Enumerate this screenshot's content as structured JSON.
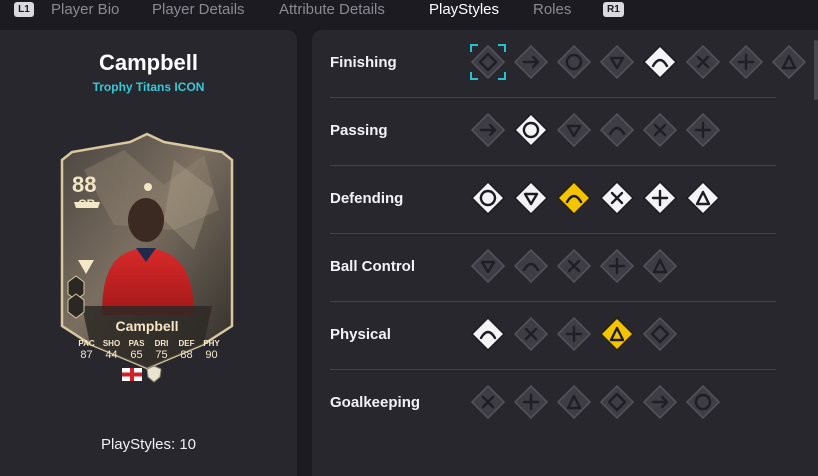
{
  "tabs": {
    "left_shoulder": "L1",
    "right_shoulder": "R1",
    "items": [
      {
        "label": "Player Bio",
        "active": false
      },
      {
        "label": "Player Details",
        "active": false
      },
      {
        "label": "Attribute Details",
        "active": false
      },
      {
        "label": "PlayStyles",
        "active": true
      },
      {
        "label": "Roles",
        "active": false
      }
    ]
  },
  "player": {
    "name": "Campbell",
    "version": "Trophy Titans ICON",
    "playstyles_count": "PlayStyles: 10"
  },
  "card": {
    "rating": "88",
    "position": "CB",
    "name": "Campbell",
    "stats": [
      {
        "label": "PAC",
        "value": "87"
      },
      {
        "label": "SHO",
        "value": "44"
      },
      {
        "label": "PAS",
        "value": "65"
      },
      {
        "label": "DRI",
        "value": "75"
      },
      {
        "label": "DEF",
        "value": "88"
      },
      {
        "label": "PHY",
        "value": "90"
      }
    ],
    "nation_icon": "england-flag-icon",
    "club_icon": "icons-club-badge-icon"
  },
  "colors": {
    "background": "#1c1b22",
    "panel": "#28272e",
    "icon_inactive": "#3e3d45",
    "icon_active": "#f4f4f6",
    "icon_plus": "#f5c400",
    "version_text": "#36c9d6",
    "focus": "#27c0d0"
  },
  "categories": [
    {
      "label": "Finishing",
      "icons": [
        {
          "name": "finesse-shot-icon",
          "state": "inactive",
          "focused": true
        },
        {
          "name": "chip-shot-icon",
          "state": "inactive"
        },
        {
          "name": "power-shot-icon",
          "state": "inactive"
        },
        {
          "name": "dead-ball-icon",
          "state": "inactive"
        },
        {
          "name": "power-header-icon",
          "state": "active"
        },
        {
          "name": "acrobatic-icon",
          "state": "inactive"
        },
        {
          "name": "low-driven-shot-icon",
          "state": "inactive"
        },
        {
          "name": "gamechanger-icon",
          "state": "inactive"
        }
      ]
    },
    {
      "label": "Passing",
      "icons": [
        {
          "name": "incisive-pass-icon",
          "state": "inactive"
        },
        {
          "name": "pinged-pass-icon",
          "state": "active"
        },
        {
          "name": "long-ball-pass-icon",
          "state": "inactive"
        },
        {
          "name": "tiki-taka-icon",
          "state": "inactive"
        },
        {
          "name": "whipped-pass-icon",
          "state": "inactive"
        },
        {
          "name": "inventive-icon",
          "state": "inactive"
        }
      ]
    },
    {
      "label": "Defending",
      "icons": [
        {
          "name": "jockey-icon",
          "state": "active"
        },
        {
          "name": "block-icon",
          "state": "active"
        },
        {
          "name": "intercept-icon",
          "state": "plus"
        },
        {
          "name": "anticipate-icon",
          "state": "active"
        },
        {
          "name": "slide-tackle-icon",
          "state": "active"
        },
        {
          "name": "bruiser-icon",
          "state": "active"
        }
      ]
    },
    {
      "label": "Ball Control",
      "icons": [
        {
          "name": "technical-icon",
          "state": "inactive"
        },
        {
          "name": "rapid-icon",
          "state": "inactive"
        },
        {
          "name": "first-touch-icon",
          "state": "inactive"
        },
        {
          "name": "trickster-icon",
          "state": "inactive"
        },
        {
          "name": "press-proven-icon",
          "state": "inactive"
        }
      ]
    },
    {
      "label": "Physical",
      "icons": [
        {
          "name": "quick-step-icon",
          "state": "active"
        },
        {
          "name": "relentless-icon",
          "state": "inactive"
        },
        {
          "name": "trivela-icon",
          "state": "inactive"
        },
        {
          "name": "aerial-icon",
          "state": "plus"
        },
        {
          "name": "long-throw-icon",
          "state": "inactive"
        }
      ]
    },
    {
      "label": "Goalkeeping",
      "icons": [
        {
          "name": "far-throw-icon",
          "state": "inactive"
        },
        {
          "name": "footwork-icon",
          "state": "inactive"
        },
        {
          "name": "cross-claimer-icon",
          "state": "inactive"
        },
        {
          "name": "rush-out-icon",
          "state": "inactive"
        },
        {
          "name": "far-reach-icon",
          "state": "inactive"
        },
        {
          "name": "deflector-icon",
          "state": "inactive"
        }
      ]
    }
  ]
}
